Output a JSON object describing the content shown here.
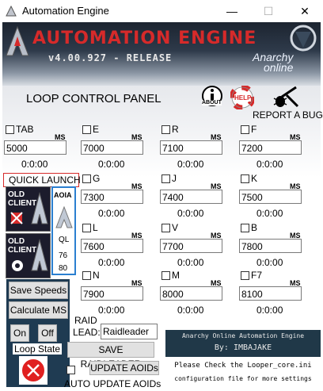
{
  "window": {
    "title": "Automation Engine",
    "minimize": "—",
    "maximize": "☐",
    "close": "✕"
  },
  "banner": {
    "title": "AUTOMATION ENGINE",
    "version": "v4.00.927 - RELEASE",
    "logo_line1": "Anarchy",
    "logo_line2": "online"
  },
  "header": {
    "panel_title": "LOOP CONTROL PANEL",
    "about": "ABOUT",
    "help": "HELP",
    "report_bug": "REPORT A BUG"
  },
  "ms_label": "MS",
  "keys": [
    {
      "key": "TAB",
      "value": "5000",
      "time": "0:0:00"
    },
    {
      "key": "E",
      "value": "7000",
      "time": "0:0:00"
    },
    {
      "key": "R",
      "value": "7100",
      "time": "0:0:00"
    },
    {
      "key": "F",
      "value": "7200",
      "time": "0:0:00"
    },
    {
      "key": "G",
      "value": "7300",
      "time": "0:0:00"
    },
    {
      "key": "J",
      "value": "7400",
      "time": "0:0:00"
    },
    {
      "key": "K",
      "value": "7500",
      "time": "0:0:00"
    },
    {
      "key": "L",
      "value": "7600",
      "time": "0:0:00"
    },
    {
      "key": "V",
      "value": "7700",
      "time": "0:0:00"
    },
    {
      "key": "B",
      "value": "7800",
      "time": "0:0:00"
    },
    {
      "key": "N",
      "value": "7900",
      "time": "0:0:00"
    },
    {
      "key": "M",
      "value": "8000",
      "time": "0:0:00"
    },
    {
      "key": "F7",
      "value": "8100",
      "time": "0:0:00"
    }
  ],
  "quick_launch": {
    "title": "QUICK LAUNCH",
    "old_client": "OLD CLIENT",
    "aoia": "AOIA",
    "ql": "QL",
    "ql_values": [
      "76",
      "80"
    ]
  },
  "controls": {
    "save_speeds": "Save Speeds",
    "calculate_ms": "Calculate MS",
    "on": "On",
    "off": "Off",
    "loop_state": "Loop State"
  },
  "raid": {
    "label_line1": "RAID",
    "label_line2": "LEAD:",
    "leader_value": "Raidleader",
    "save_button": "SAVE RAIDLEADER",
    "update_aoids": "UPDATE AOIDs",
    "auto_update": "AUTO UPDATE AOIDs"
  },
  "info": {
    "line1": "Anarchy Online Automation Engine",
    "line2": "By: IMBAJAKE",
    "line3": "Please Check the Looper_core.ini",
    "line4": "configuration file for more settings"
  },
  "colors": {
    "brand_red": "#d62a2a",
    "panel_dark": "#1f3b52",
    "stop_red": "#e02020"
  }
}
